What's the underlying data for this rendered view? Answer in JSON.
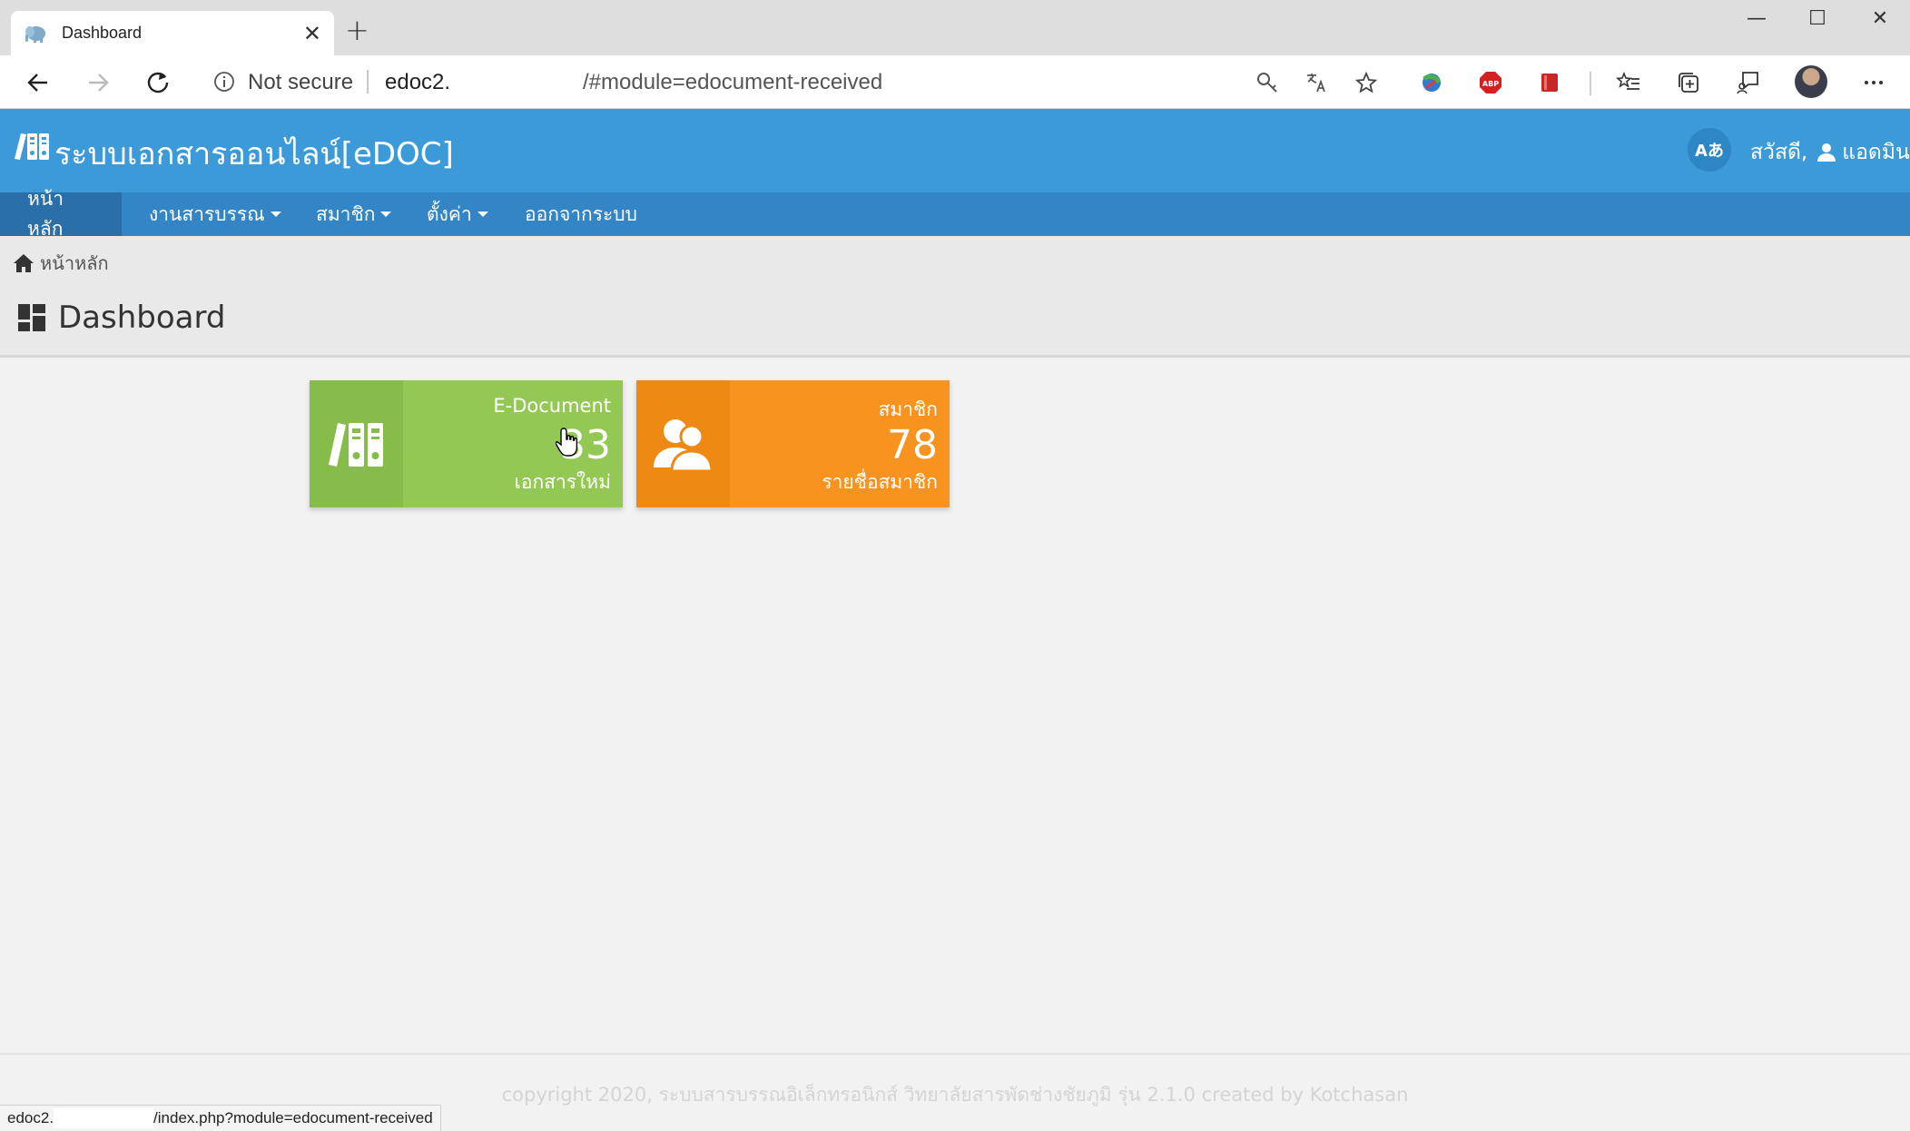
{
  "browser": {
    "tab_title": "Dashboard",
    "address_security": "Not secure",
    "address_host": "edoc2.",
    "address_path": "/#module=edocument-received",
    "status_url_prefix": "edoc2.",
    "status_url_suffix": "/index.php?module=edocument-received"
  },
  "header": {
    "site_title": "ระบบเอกสารออนไลน์[eDOC]",
    "lang_button": "Aあ",
    "greeting": "สวัสดี,",
    "username": "แอดมิน"
  },
  "nav": {
    "items": [
      {
        "label": "หน้าหลัก",
        "active": true
      },
      {
        "label": "งานสารบรรณ",
        "dropdown": true
      },
      {
        "label": "สมาชิก",
        "dropdown": true
      },
      {
        "label": "ตั้งค่า",
        "dropdown": true
      },
      {
        "label": "ออกจากระบบ"
      }
    ]
  },
  "breadcrumb": {
    "home": "หน้าหลัก"
  },
  "page": {
    "title": "Dashboard"
  },
  "cards": [
    {
      "label": "E-Document",
      "count": "33",
      "sub": "เอกสารใหม่",
      "color": "#94c854",
      "icon": "binders-icon"
    },
    {
      "label": "สมาชิก",
      "count": "78",
      "sub": "รายชื่อสมาชิก",
      "color": "#f7931e",
      "icon": "users-icon"
    }
  ],
  "footer": {
    "copyright": "copyright 2020, ระบบสารบรรณอิเล็กทรอนิกส์ วิทยาลัยสารพัดช่างชัยภูมิ รุ่น 2.1.0 created by Kotchasan"
  }
}
